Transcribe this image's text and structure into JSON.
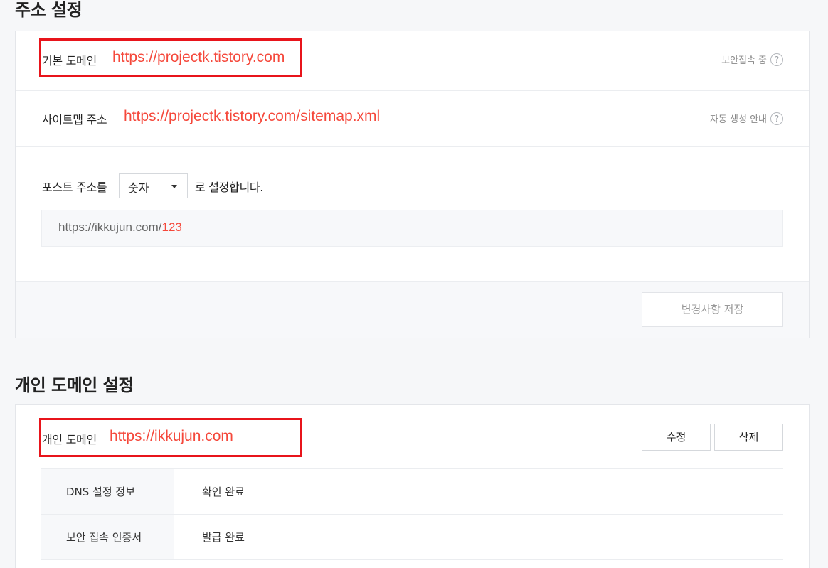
{
  "address_settings": {
    "title": "주소 설정",
    "default_domain": {
      "label": "기본 도메인",
      "url": "https://projectk.tistory.com",
      "note": "보안접속 중"
    },
    "sitemap": {
      "label": "사이트맵 주소",
      "url": "https://projectk.tistory.com/sitemap.xml",
      "note": "자동 생성 안내"
    },
    "post_address": {
      "prefix": "포스트 주소를",
      "selected": "숫자",
      "suffix": "로 설정합니다."
    },
    "preview": {
      "base": "https://ikkujun.com/",
      "number": "123"
    },
    "save_button": "변경사항 저장"
  },
  "custom_domain": {
    "title": "개인 도메인 설정",
    "label": "개인 도메인",
    "url": "https://ikkujun.com",
    "edit_button": "수정",
    "delete_button": "삭제",
    "info_rows": [
      {
        "key": "DNS 설정 정보",
        "value": "확인 완료"
      },
      {
        "key": "보안 접속 인증서",
        "value": "발급 완료"
      }
    ]
  },
  "help_icon_glyph": "?",
  "colors": {
    "accent": "#f5483b",
    "highlight": "#e8141b"
  }
}
